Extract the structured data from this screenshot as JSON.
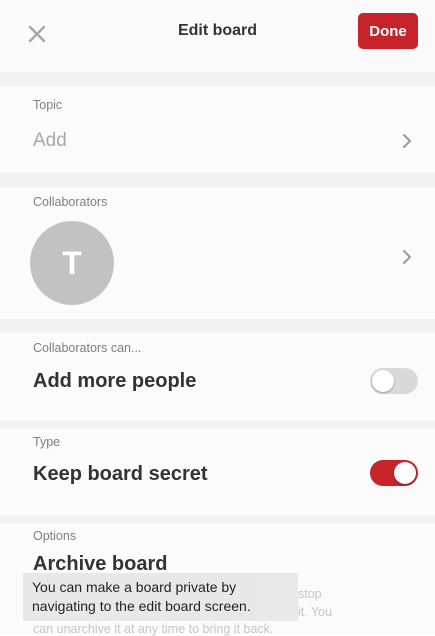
{
  "header": {
    "title": "Edit board",
    "close_icon": "close-icon",
    "done_label": "Done",
    "accent": "#c7232b"
  },
  "topic": {
    "label": "Topic",
    "value": "Add"
  },
  "collaborators": {
    "label": "Collaborators",
    "avatar_initial": "T"
  },
  "collaborators_can": {
    "label": "Collaborators can...",
    "value": "Add more people",
    "toggle_on": false
  },
  "type": {
    "label": "Type",
    "value": "Keep board secret",
    "toggle_on": true
  },
  "options": {
    "label": "Options",
    "value": "Archive board",
    "desc_line1_fragment": "stop",
    "desc_line2_fragment": "it. You",
    "desc_line3": "can unarchive it at any time to bring it back."
  },
  "caption": {
    "line1": "You can make a board private by",
    "line2": "navigating to the edit board screen."
  }
}
